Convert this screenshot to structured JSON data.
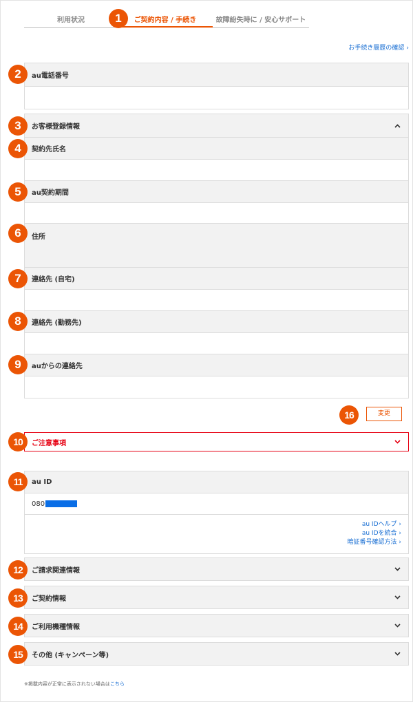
{
  "tabs": [
    "利用状況",
    "ご契約内容 / 手続き",
    "故障紛失時に / 安心サポート"
  ],
  "history_link": "お手続き履歴の確認",
  "phone_section": {
    "title": "au電話番号",
    "value": ""
  },
  "customer_section": {
    "title": "お客様登録情報",
    "fields": [
      "契約先氏名",
      "au契約期間",
      "住所",
      "連絡先 (自宅)",
      "連絡先 (勤務先)",
      "auからの連絡先"
    ]
  },
  "change_button": "変更",
  "notice": "ご注意事項",
  "auid_section": {
    "title": "au ID",
    "value_prefix": "080",
    "links": [
      "au IDヘルプ",
      "au IDを統合",
      "暗証番号確認方法"
    ]
  },
  "accordions": [
    "ご請求関連情報",
    "ご契約情報",
    "ご利用機種情報",
    "その他 (キャンペーン等)"
  ],
  "footnote": {
    "text": "※掲載内容が正常に表示されない場合は",
    "link": "こちら"
  },
  "markers": [
    "1",
    "2",
    "3",
    "4",
    "5",
    "6",
    "7",
    "8",
    "9",
    "10",
    "11",
    "12",
    "13",
    "14",
    "15",
    "16"
  ],
  "colors": {
    "accent": "#eb5505",
    "alert": "#e60012",
    "link": "#1a6fd3",
    "header_bg": "#f2f2f2"
  },
  "icons": {
    "collapse": "chevron-up-icon",
    "expand": "chevron-down-icon",
    "link_arrow": "chevron-right-icon"
  }
}
